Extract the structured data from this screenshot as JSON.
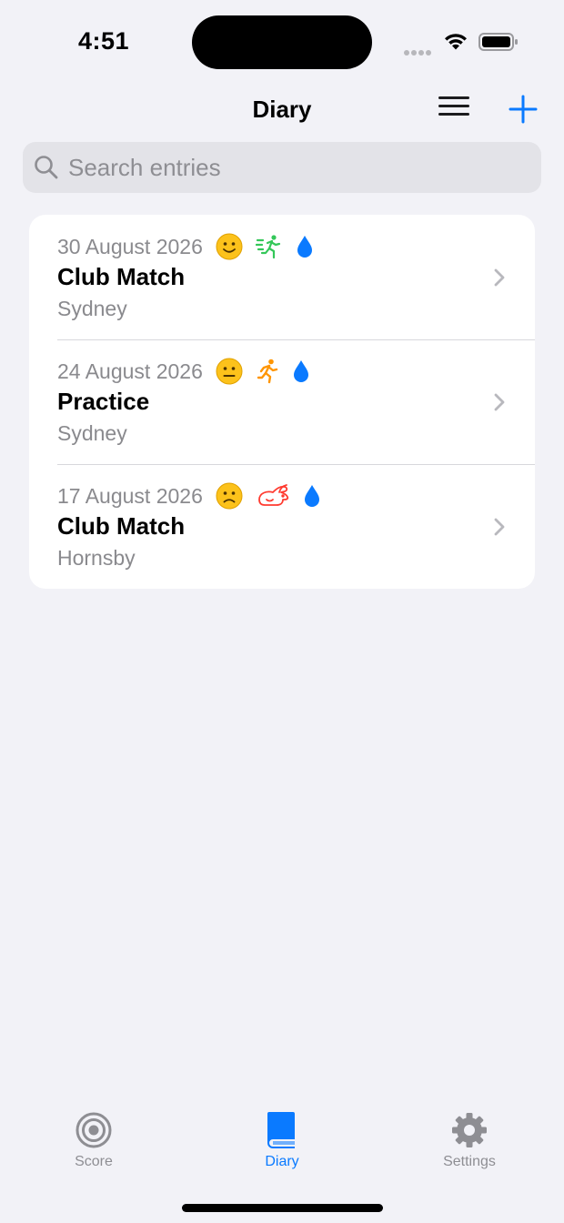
{
  "status_bar": {
    "time": "4:51"
  },
  "nav": {
    "title": "Diary"
  },
  "search": {
    "placeholder": "Search entries"
  },
  "entries": [
    {
      "date": "30 August 2026",
      "title": "Club Match",
      "location": "Sydney",
      "mood": "smiling-face",
      "activity": "person-running-fast",
      "activity_color": "#34c759",
      "hydration": "drop"
    },
    {
      "date": "24 August 2026",
      "title": "Practice",
      "location": "Sydney",
      "mood": "neutral-face",
      "activity": "person-running",
      "activity_color": "#ff9500",
      "hydration": "drop"
    },
    {
      "date": "17 August 2026",
      "title": "Club Match",
      "location": "Hornsby",
      "mood": "slightly-frowning-face",
      "activity": "rabbit",
      "activity_color": "#ff3b30",
      "hydration": "drop"
    }
  ],
  "tabs": [
    {
      "label": "Score",
      "icon": "target-icon",
      "active": false
    },
    {
      "label": "Diary",
      "icon": "book-icon",
      "active": true
    },
    {
      "label": "Settings",
      "icon": "gear-icon",
      "active": false
    }
  ],
  "colors": {
    "accent": "#0a7aff",
    "background": "#f2f2f7",
    "secondary_text": "#8a8a8e"
  }
}
